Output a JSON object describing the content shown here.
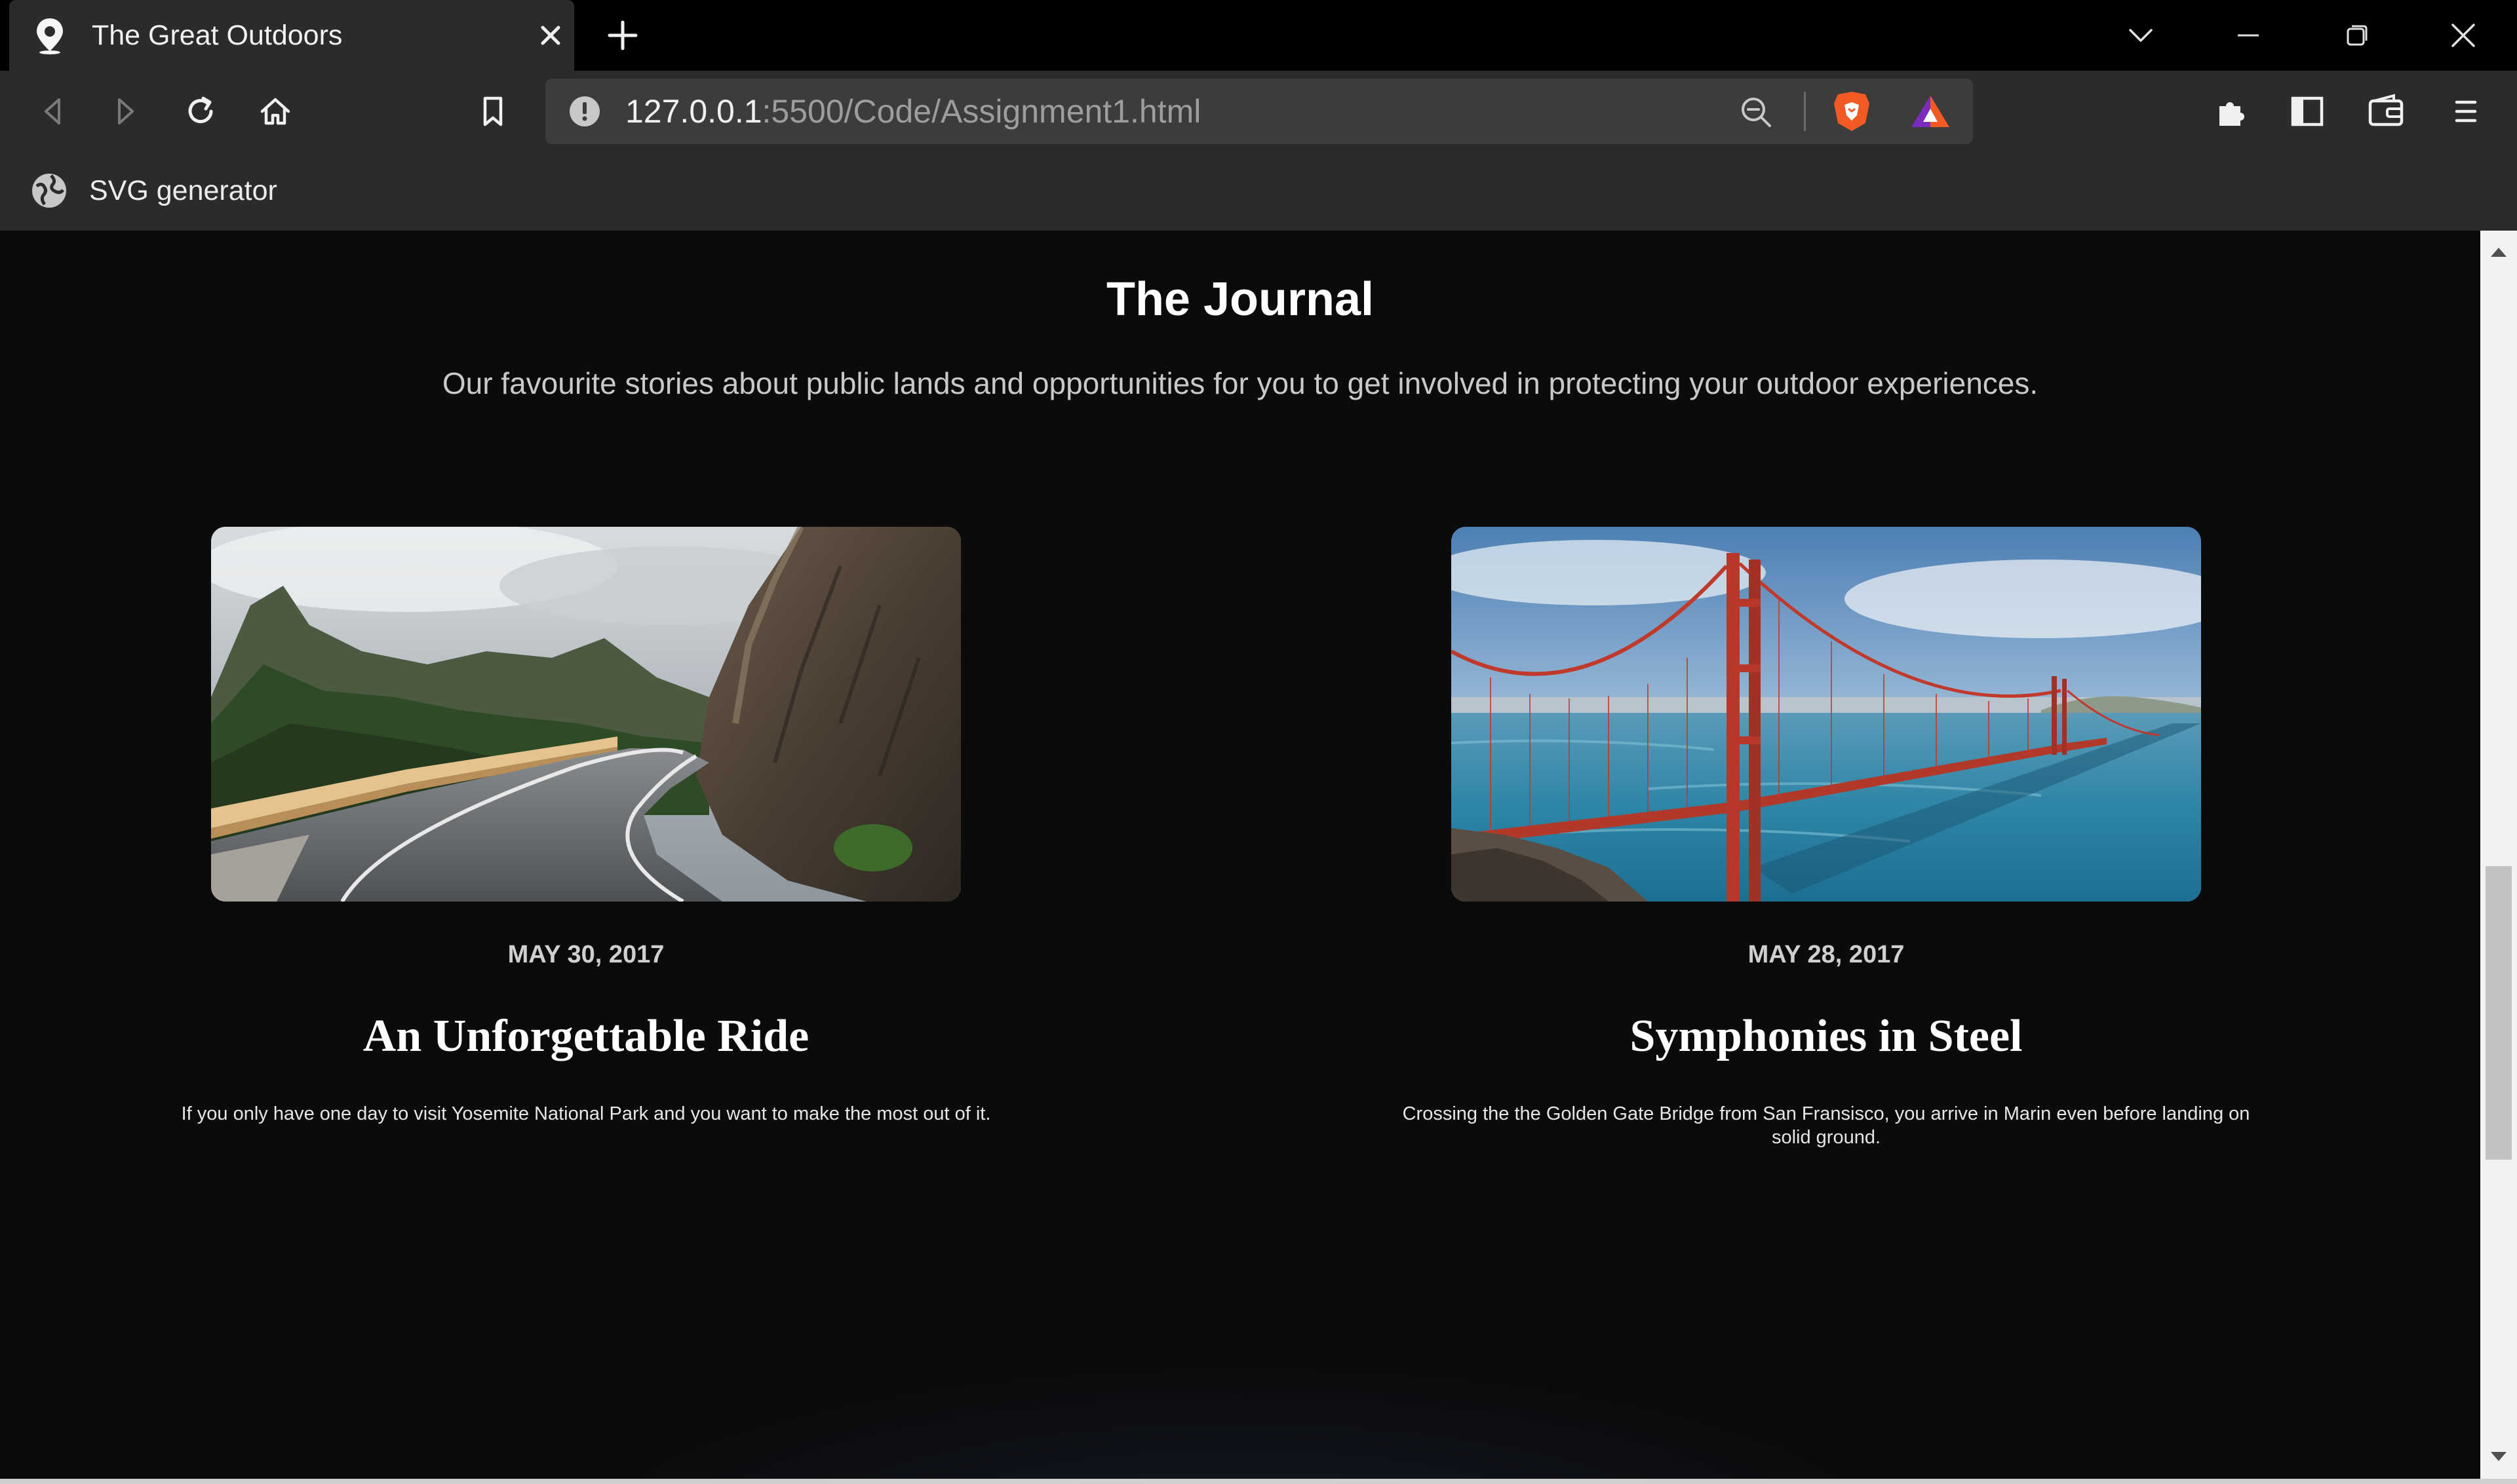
{
  "browser": {
    "tab": {
      "title": "The Great Outdoors",
      "icon": "map-pin-icon"
    },
    "url": {
      "host": "127.0.0.1",
      "path": ":5500/Code/Assignment1.html"
    },
    "bookmarks": [
      {
        "label": "SVG generator",
        "icon": "globe-icon"
      }
    ]
  },
  "page": {
    "title": "The Journal",
    "subtitle": "Our favourite stories about public lands and opportunities for you to get involved in protecting your outdoor experiences.",
    "cards": [
      {
        "date": "MAY 30, 2017",
        "title": "An Unforgettable Ride",
        "text": "If you only have one day to visit Yosemite National Park and you want to make the most out of it.",
        "image": "mountain-road-photo"
      },
      {
        "date": "MAY 28, 2017",
        "title": "Symphonies in Steel",
        "text": "Crossing the the Golden Gate Bridge from San Fransisco, you arrive in Marin even before landing on solid ground.",
        "image": "golden-gate-bridge-photo"
      }
    ]
  },
  "colors": {
    "chrome_dark": "#000000",
    "chrome_toolbar": "#2b2b2b",
    "page_background": "#0b0b0c",
    "brave_orange": "#f15a22",
    "bridge_red": "#c0392b"
  }
}
